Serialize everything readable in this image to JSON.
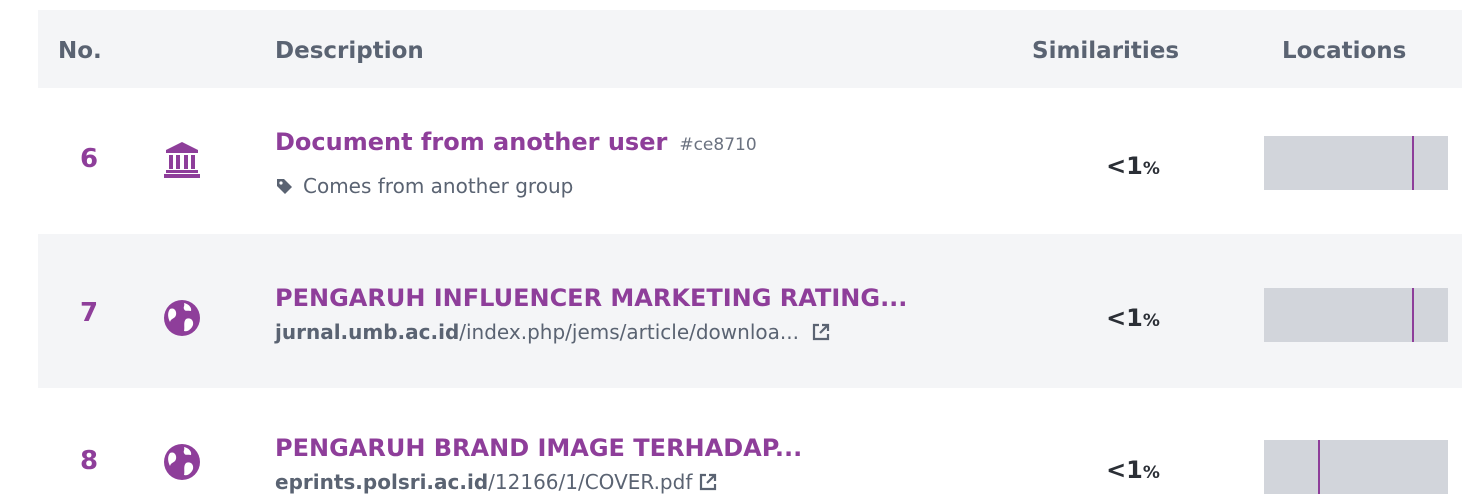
{
  "header": {
    "no": "No.",
    "description": "Description",
    "similarities": "Similarities",
    "locations": "Locations"
  },
  "rows": [
    {
      "number": "6",
      "icon": "institution-icon",
      "title": "Document from another user",
      "hash": "#ce8710",
      "subtitle": "Comes from another group",
      "similarity": "<1",
      "similarity_unit": "%",
      "location_marks": [
        0.81
      ]
    },
    {
      "number": "7",
      "icon": "globe-icon",
      "title": "PENGARUH INFLUENCER MARKETING RATING...",
      "url_host": "jurnal.umb.ac.id",
      "url_path": "/index.php/jems/article/downloa...",
      "similarity": "<1",
      "similarity_unit": "%",
      "location_marks": [
        0.81
      ]
    },
    {
      "number": "8",
      "icon": "globe-icon",
      "title": "PENGARUH BRAND IMAGE TERHADAP...",
      "url_host": "eprints.polsri.ac.id",
      "url_path": "/12166/1/COVER.pdf",
      "similarity": "<1",
      "similarity_unit": "%",
      "location_marks": [
        0.3
      ]
    }
  ],
  "colors": {
    "accent": "#8e3e9a",
    "bar": "#d2d5db",
    "header_bg": "#f4f5f7",
    "text": "#5a6372"
  }
}
